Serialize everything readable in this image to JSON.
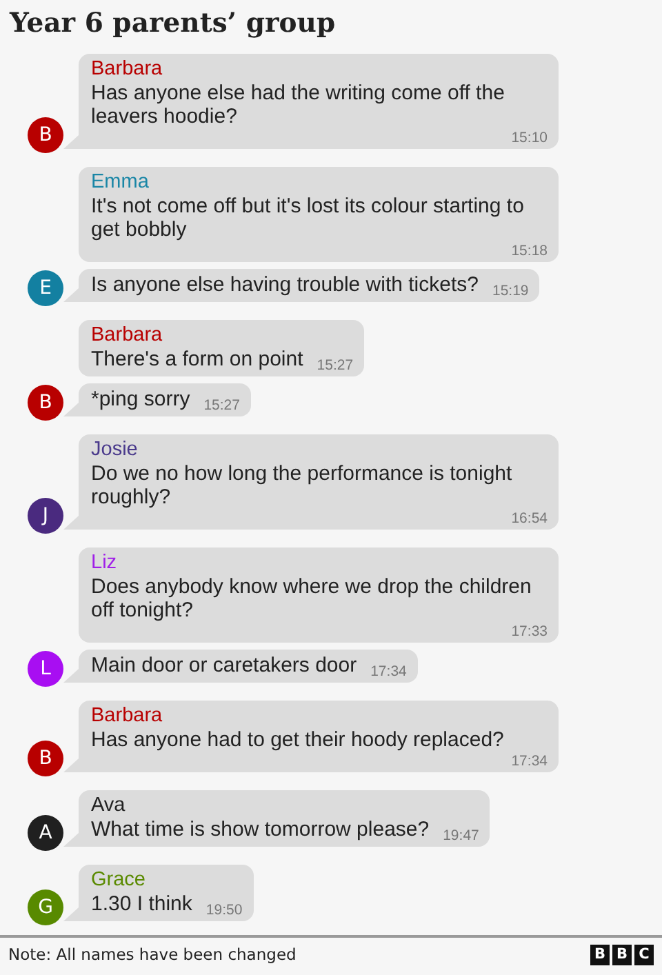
{
  "title": "Year 6 parents’ group",
  "messages": [
    {
      "sender": {
        "name": "Barbara",
        "color": "#b80000"
      },
      "text": "Has anyone else had the writing come off the leavers hoodie?",
      "time": "15:10",
      "avatar": {
        "letter": "B",
        "color": "#b80000"
      }
    },
    {
      "sender": {
        "name": "Emma",
        "color": "#1a86a6"
      },
      "text": "It's not come off but it's lost its colour starting to get bobbly",
      "time": "15:18"
    },
    {
      "text": "Is anyone else having trouble with tickets?",
      "time": "15:19",
      "avatar": {
        "letter": "E",
        "color": "#1380a1"
      }
    },
    {
      "sender": {
        "name": "Barbara",
        "color": "#b80000"
      },
      "text": "There's a form on point",
      "time": "15:27"
    },
    {
      "text": "*ping sorry",
      "time": "15:27",
      "avatar": {
        "letter": "B",
        "color": "#b80000"
      }
    },
    {
      "sender": {
        "name": "Josie",
        "color": "#4a3a8c"
      },
      "text": "Do we no how long the performance is tonight roughly?",
      "time": "16:54",
      "avatar": {
        "letter": "J",
        "color": "#4a2a7f"
      }
    },
    {
      "sender": {
        "name": "Liz",
        "color": "#a020e8"
      },
      "text": "Does anybody know where we drop the children off tonight?",
      "time": "17:33"
    },
    {
      "text": "Main door or caretakers door",
      "time": "17:34",
      "avatar": {
        "letter": "L",
        "color": "#a80ef2"
      }
    },
    {
      "sender": {
        "name": "Barbara",
        "color": "#b80000"
      },
      "text": "Has anyone had to get their hoody replaced?",
      "time": "17:34",
      "avatar": {
        "letter": "B",
        "color": "#b80000"
      }
    },
    {
      "sender": {
        "name": "Ava",
        "color": "#222222"
      },
      "text": "What time is show tomorrow please?",
      "time": "19:47",
      "avatar": {
        "letter": "A",
        "color": "#202020"
      }
    },
    {
      "sender": {
        "name": "Grace",
        "color": "#5a8a00"
      },
      "text": "1.30 I think",
      "time": "19:50",
      "avatar": {
        "letter": "G",
        "color": "#588a00"
      }
    }
  ],
  "footer": {
    "note": "Note: All names have been changed",
    "logo": [
      "B",
      "B",
      "C"
    ]
  }
}
